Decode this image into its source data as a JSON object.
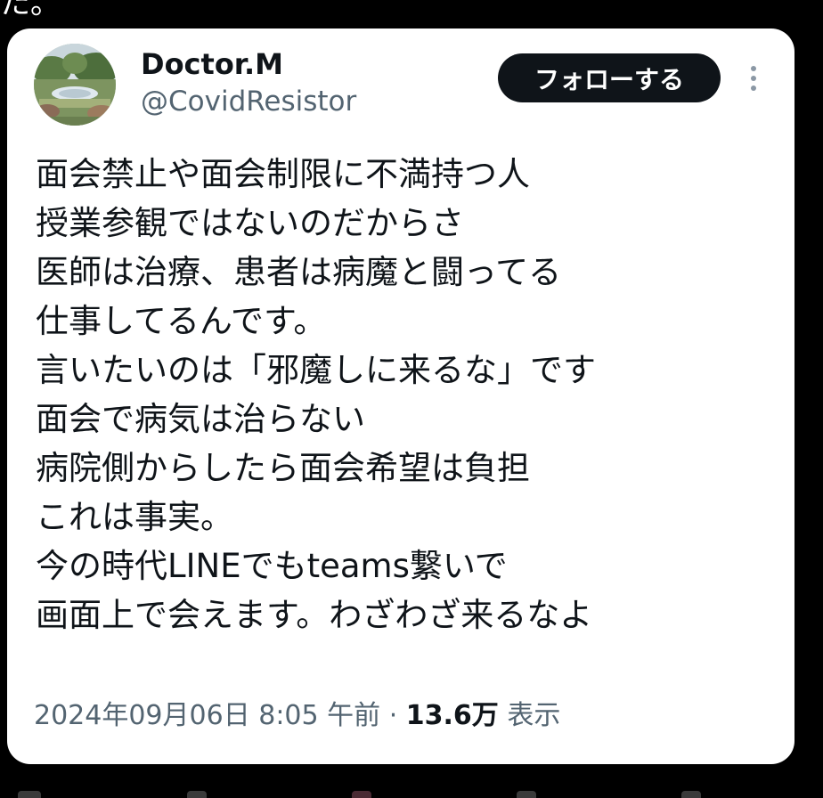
{
  "header_fragment": "た。",
  "tweet": {
    "display_name": "Doctor.M",
    "handle": "@CovidResistor",
    "follow_label": "フォローする",
    "lines": [
      "面会禁止や面会制限に不満持つ人",
      "授業参観ではないのだからさ",
      "医師は治療、患者は病魔と闘ってる",
      "仕事してるんです。",
      "言いたいのは「邪魔しに来るな」です",
      "面会で病気は治らない",
      "病院側からしたら面会希望は負担",
      "これは事実。",
      "今の時代LINEでもteams繋いで",
      "画面上で会えます。わざわざ来るなよ"
    ],
    "timestamp": "2024年09月06日 8:05 午前",
    "separator": "·",
    "views_count": "13.6万",
    "views_label": "表示"
  },
  "icons": {
    "more": "more-vertical-icon",
    "avatar": "garden-photo-avatar"
  },
  "colors": {
    "background": "#000000",
    "card": "#ffffff",
    "text_primary": "#0f1419",
    "text_secondary": "#536471",
    "follow_button": "#0f1419"
  }
}
